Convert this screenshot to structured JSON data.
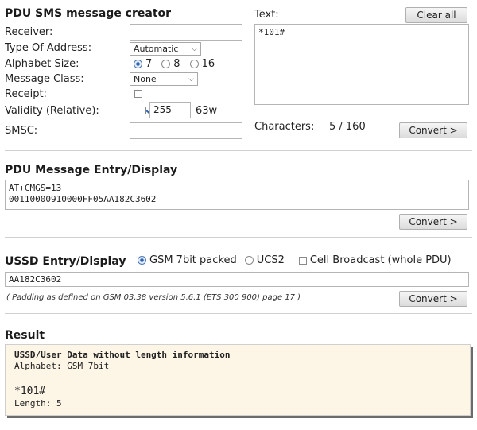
{
  "sms": {
    "title": "PDU SMS message creator",
    "receiver_label": "Receiver:",
    "receiver_value": "",
    "type_label": "Type Of Address:",
    "type_value": "Automatic",
    "alphabet_label": "Alphabet Size:",
    "alphabet_options": [
      "7",
      "8",
      "16"
    ],
    "alphabet_selected": "7",
    "class_label": "Message Class:",
    "class_value": "None",
    "receipt_label": "Receipt:",
    "receipt_checked": false,
    "validity_label": "Validity (Relative):",
    "validity_checked": true,
    "validity_value": "255",
    "validity_unit": "63w",
    "smsc_label": "SMSC:",
    "smsc_value": "",
    "text_label": "Text:",
    "clear_label": "Clear all",
    "text_value": "*101#",
    "characters_label": "Characters:",
    "characters_value": "5 / 160",
    "convert_label": "Convert >"
  },
  "pdu": {
    "title": "PDU Message Entry/Display",
    "line1": "AT+CMGS=13",
    "line2": "00110000910000FF05AA182C3602",
    "convert_label": "Convert >"
  },
  "ussd": {
    "title": "USSD Entry/Display",
    "option_gsm": "GSM 7bit packed",
    "option_ucs2": "UCS2",
    "option_cb": "Cell Broadcast (whole PDU)",
    "selected": "GSM 7bit packed",
    "value": "AA182C3602",
    "note": "( Padding as defined on GSM 03.38 version 5.6.1 (ETS 300 900) page 17 )",
    "convert_label": "Convert >"
  },
  "result": {
    "title": "Result",
    "heading": "USSD/User Data without length information",
    "alphabet": "Alphabet: GSM 7bit",
    "decoded": "*101#",
    "length": "Length: 5"
  },
  "colors": {
    "result_bg": "#fdf5e6",
    "radio_accent": "#2c63b0"
  }
}
